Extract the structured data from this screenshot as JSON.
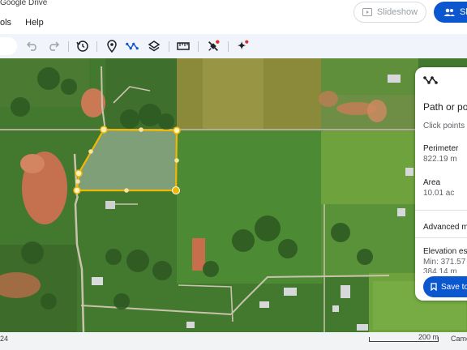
{
  "header": {
    "doc_title": "Google Drive",
    "menu": [
      "ols",
      "Help"
    ],
    "slideshow_label": "Slideshow",
    "share_label": "Sh"
  },
  "toolbar": {
    "icons": [
      "undo-icon",
      "redo-icon",
      "history-icon",
      "add-placemark-icon",
      "draw-line-icon",
      "layers-icon",
      "measure-icon",
      "satellite-icon",
      "gemini-icon"
    ]
  },
  "panel": {
    "title": "Path or pol",
    "hint": "Click points o",
    "perimeter_label": "Perimeter",
    "perimeter_value": "822.19 m",
    "area_label": "Area",
    "area_value": "10.01 ac",
    "advanced_label": "Advanced m",
    "elevation_label": "Elevation est",
    "elevation_min": "Min: 371.57 m",
    "elevation_max": "384.14 m",
    "save_label": "Save to"
  },
  "status": {
    "left_text": "24",
    "scale_text": "200 m",
    "right_text": "Came"
  },
  "colors": {
    "accent": "#0b57d0",
    "polygon": "#f2b705"
  }
}
